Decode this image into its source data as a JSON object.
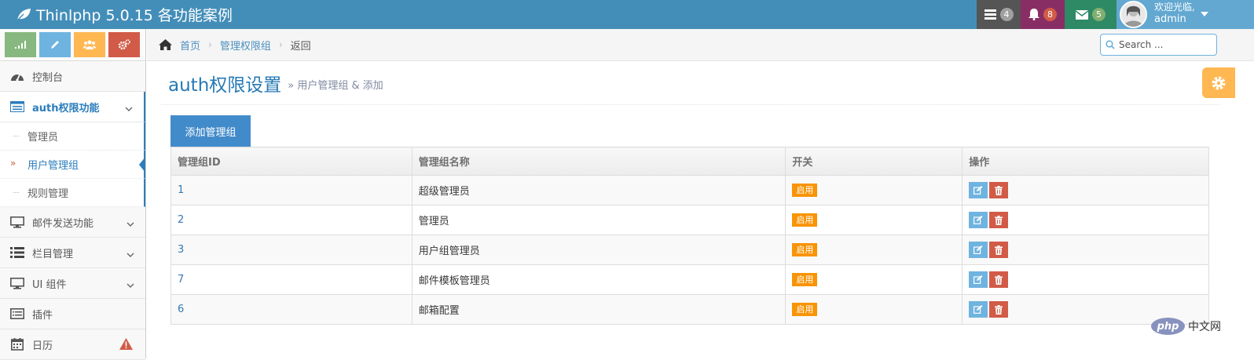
{
  "navbar": {
    "brand": "Thinlphp 5.0.15 各功能案例",
    "tasks_count": "4",
    "notifications_count": "8",
    "messages_count": "5",
    "user_greeting": "欢迎光临,",
    "user_name": "admin",
    "colors": {
      "navbar": "#438eb9",
      "tasks": "#555555",
      "notifications": "#892e65",
      "messages": "#2e8965",
      "user": "#62a8d1"
    }
  },
  "sidebar": {
    "shortcut_colors": [
      "#87b87f",
      "#6fb3e0",
      "#ffb752",
      "#d15b47"
    ],
    "items": [
      {
        "label": "控制台",
        "icon": "dashboard-icon"
      },
      {
        "label": "auth权限功能",
        "icon": "list-icon"
      },
      {
        "label": "邮件发送功能",
        "icon": "desktop-icon"
      },
      {
        "label": "栏目管理",
        "icon": "list-icon"
      },
      {
        "label": "UI 组件",
        "icon": "desktop-icon"
      },
      {
        "label": "插件",
        "icon": "list-alt-icon"
      },
      {
        "label": "日历",
        "icon": "calendar-icon"
      }
    ],
    "submenu": [
      {
        "label": "管理员"
      },
      {
        "label": "用户管理组"
      },
      {
        "label": "规则管理"
      }
    ]
  },
  "breadcrumb": {
    "home": "首页",
    "group": "管理权限组",
    "current": "返回"
  },
  "search": {
    "placeholder": "Search ..."
  },
  "page": {
    "title": "auth权限设置",
    "subtitle": "» 用户管理组 & 添加"
  },
  "tab": {
    "label": "添加管理组"
  },
  "table": {
    "headers": [
      "管理组ID",
      "管理组名称",
      "开关",
      "操作"
    ],
    "rows": [
      {
        "id": "1",
        "name": "超级管理员",
        "status": "启用"
      },
      {
        "id": "2",
        "name": "管理员",
        "status": "启用"
      },
      {
        "id": "3",
        "name": "用户组管理员",
        "status": "启用"
      },
      {
        "id": "7",
        "name": "邮件模板管理员",
        "status": "启用"
      },
      {
        "id": "6",
        "name": "邮箱配置",
        "status": "启用"
      }
    ]
  },
  "watermark": {
    "logo": "php",
    "text": "中文网"
  }
}
